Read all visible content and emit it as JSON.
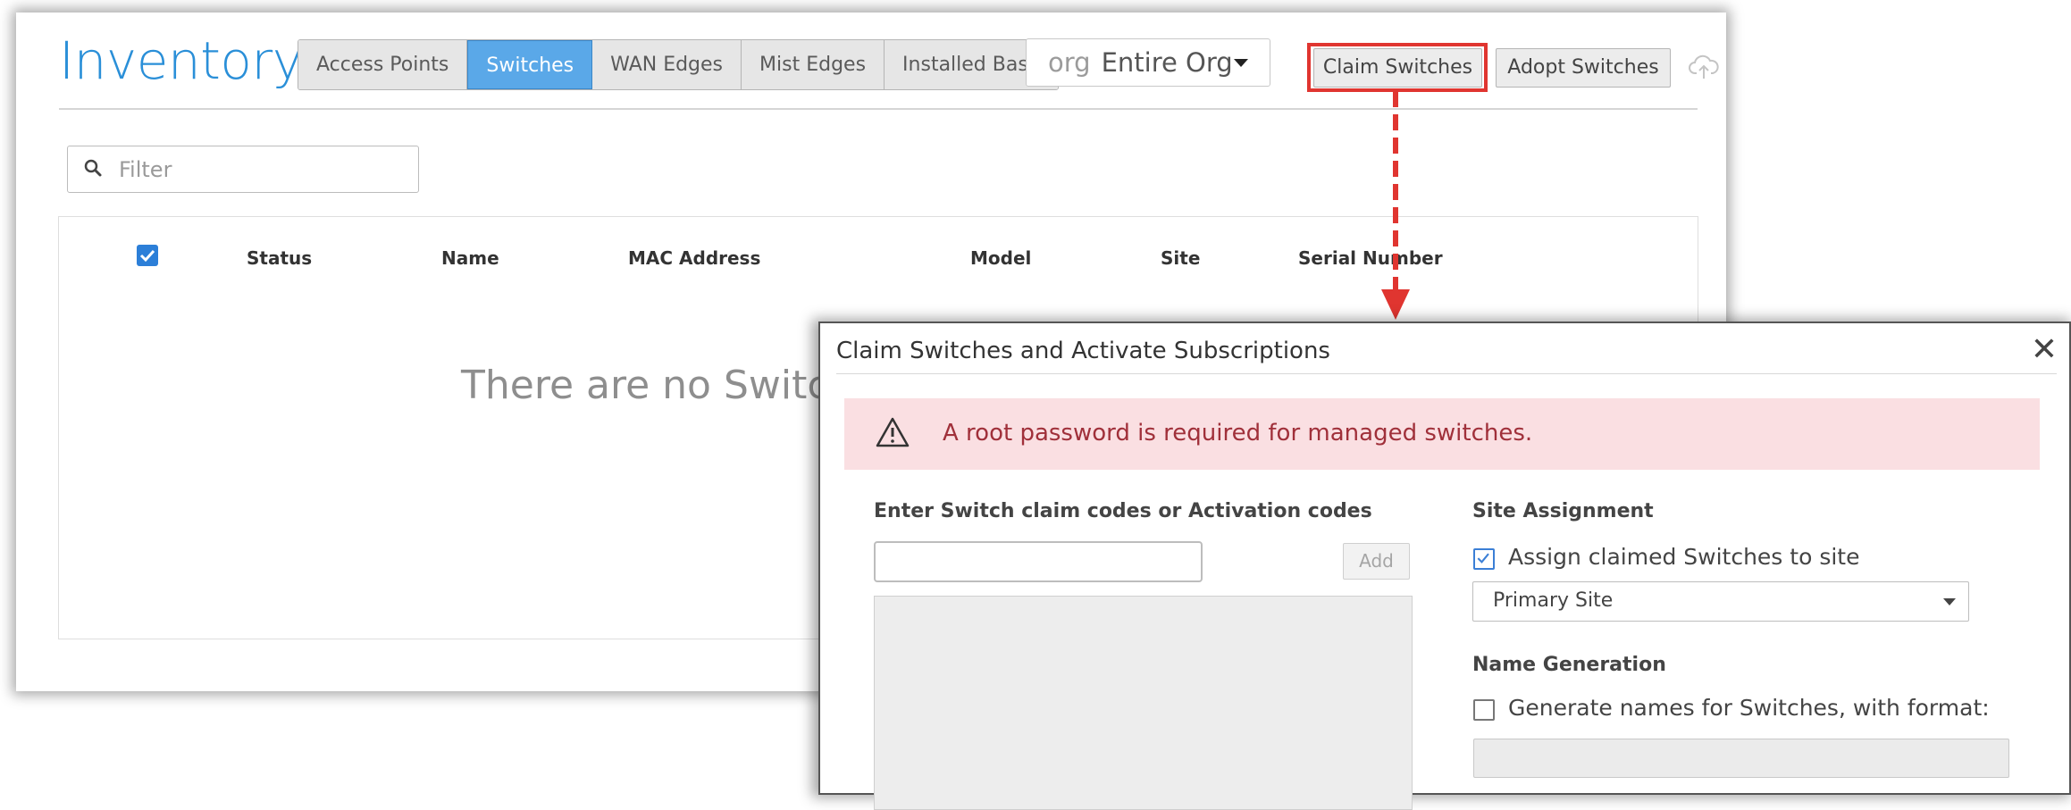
{
  "inventory": {
    "title": "Inventory",
    "tabs": [
      {
        "label": "Access Points",
        "active": false
      },
      {
        "label": "Switches",
        "active": true
      },
      {
        "label": "WAN Edges",
        "active": false
      },
      {
        "label": "Mist Edges",
        "active": false
      },
      {
        "label": "Installed Base",
        "active": false
      }
    ],
    "org_select": {
      "prefix": "org",
      "value": "Entire Org"
    },
    "claim_button": "Claim Switches",
    "adopt_button": "Adopt Switches",
    "filter_placeholder": "Filter",
    "table": {
      "headers": [
        "Status",
        "Name",
        "MAC Address",
        "Model",
        "Site",
        "Serial Number"
      ],
      "empty_message": "There are no Switches"
    }
  },
  "dialog": {
    "title": "Claim Switches and Activate Subscriptions",
    "alert": "A root password is required for managed switches.",
    "codes_label": "Enter Switch claim codes or Activation codes",
    "add_button": "Add",
    "site_assignment_label": "Site Assignment",
    "assign_site_checkbox": {
      "label": "Assign claimed Switches to site",
      "checked": true
    },
    "site_select_value": "Primary Site",
    "name_generation_label": "Name Generation",
    "generate_names_checkbox": {
      "label": "Generate names for Switches, with format:",
      "checked": false
    }
  },
  "colors": {
    "accent": "#2a8fd8",
    "active_tab": "#5aa8e8",
    "highlight": "#e03530",
    "alert_bg": "#fadfe2",
    "alert_text": "#a0303a"
  },
  "icons": [
    "search-icon",
    "cloud-upload-icon",
    "warning-icon",
    "close-icon",
    "chevron-down-icon",
    "checkmark-icon"
  ]
}
